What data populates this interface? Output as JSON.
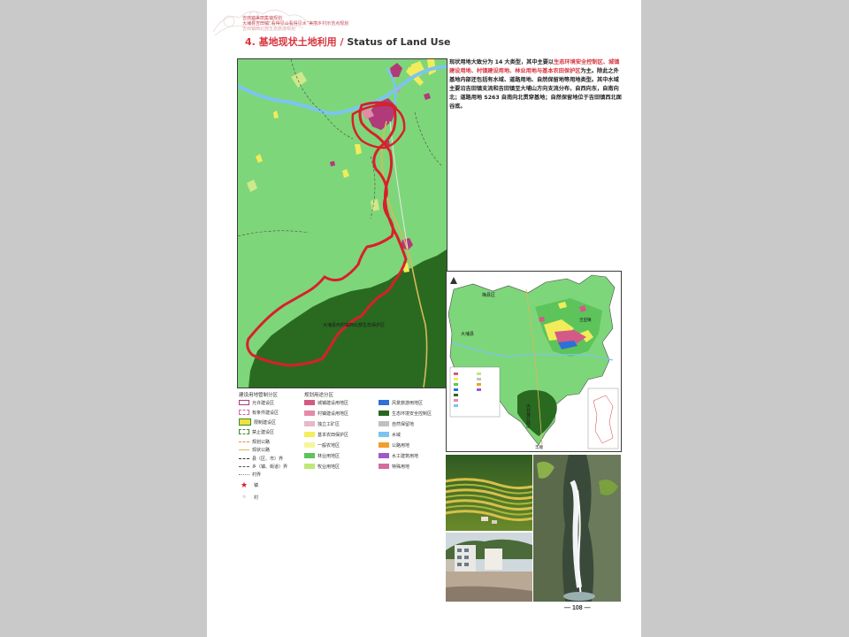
{
  "header": {
    "line1": "吉田镇美丽集镇规划",
    "line2": "大埔县吉田镇“看得见山看得见水”美丽乡村示范点规划",
    "line3": "吉田镇西北部生态旅游规划"
  },
  "section": {
    "number_title": "4. 基地现状土地利用",
    "separator": " / ",
    "title_en": "Status of Land Use"
  },
  "intro": {
    "p1": "现状用地大致分为 14 大类型，其中主要以",
    "highlight": "生态环境安全控制区、城镇建设用地、村镇建设用地、林业用地与基本农田保护区",
    "p2": "为主。除此之外基地内部还包括有水域、道路用地、自然保留地等用地类型。其中水域主要沿吉田镇支流和吉田镇至大埔山方向支流分布，自西向东，自南向北；道路用地 S263 自南向北贯穿基地；自然保留地位于吉田镇西北面谷底。"
  },
  "main_map": {
    "zone_label": "大埔县丙村镇西北部生态保护区"
  },
  "legend": {
    "col1_title": "建设用地管制分区",
    "col2_title": "规划用途分区",
    "col1": [
      {
        "label": "允许建设区"
      },
      {
        "label": "有条件建设区"
      },
      {
        "label": "限制建设区"
      },
      {
        "label": "禁止建设区"
      },
      {
        "label": "规划公路"
      },
      {
        "label": "现状公路"
      },
      {
        "label": "县（区、市）界"
      },
      {
        "label": "乡（镇、街道）界"
      },
      {
        "label": "村界"
      },
      {
        "label": "镇"
      },
      {
        "label": "村"
      }
    ],
    "col2": [
      {
        "label": "城镇建设用地区"
      },
      {
        "label": "村镇建设用地区"
      },
      {
        "label": "独立工矿区"
      },
      {
        "label": "基本农田保护区"
      },
      {
        "label": "一般农地区"
      },
      {
        "label": "林业用地区"
      },
      {
        "label": "牧业用地区"
      }
    ],
    "col3": [
      {
        "label": "风景旅游用地区"
      },
      {
        "label": "生态环境安全控制区"
      },
      {
        "label": "自然保留地"
      },
      {
        "label": "水域"
      },
      {
        "label": "公路用地"
      },
      {
        "label": "水工建筑用地"
      },
      {
        "label": "特殊用地"
      }
    ],
    "colors": {
      "allowed": "#b03a7a",
      "conditional": "#d26aa6",
      "restricted": "#f0e040",
      "forbidden": "#3d8a2a",
      "planned_road": "#e88a2a",
      "current_road": "#d9b85a",
      "urban": "#d35a86",
      "village": "#e38aa8",
      "mining": "#e8b8c8",
      "farmland": "#f6ec5c",
      "general_farm": "#f7f59a",
      "forest": "#5cc45a",
      "pasture": "#bfe878",
      "scenic": "#2f6fd8",
      "eco": "#27661e",
      "natural": "#c0c0c0",
      "water": "#7cc4f0",
      "road_land": "#f0a028",
      "hydro": "#a05ac8",
      "special": "#d86aa0",
      "star": "#d8202a"
    }
  },
  "inset_map": {
    "north_label": "梅县区",
    "west_label": "大埔县",
    "east_label": "吉田镇",
    "side_label": "丙村镇行政区",
    "bottom_label": "丰顺"
  },
  "page_number": "— 108 —"
}
